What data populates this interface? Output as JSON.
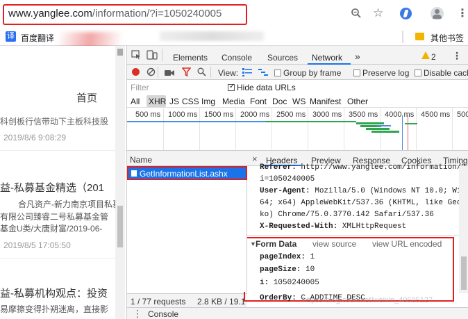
{
  "browser": {
    "url_host": "www.yanglee.com",
    "url_path": "/information/?i=1050240005",
    "bookmarks": [
      {
        "label": "百度翻译",
        "icon": "译"
      }
    ],
    "other_bookmarks": "其他书签",
    "accent": "#e02020"
  },
  "page": {
    "nav_home": "首页",
    "items": [
      {
        "line1": "科创板行信带动下主板科技股",
        "date": "2019/8/6 9:08:29"
      },
      {
        "title": "私募基金精选（201",
        "title_prefix": "益-",
        "lines": [
          "合凡资产-新力南京项目私募",
          "有限公司臻睿二号私募基金管",
          "基金U类/大唐财富/2019-06-"
        ],
        "date": "2019/8/5 17:05:50"
      },
      {
        "title": "私募机构观点：投资",
        "title_prefix": "益-",
        "line1": "易摩擦变得扑朔迷离，直接影"
      }
    ]
  },
  "devtools": {
    "tabs": [
      "Elements",
      "Console",
      "Sources",
      "Network"
    ],
    "active_tab": "Network",
    "more": "»",
    "warnings": "2",
    "toolbar": {
      "view_label": "View:",
      "group_by_frame": "Group by frame",
      "preserve_log": "Preserve log",
      "disable_cache": "Disable cach"
    },
    "filter_placeholder": "Filter",
    "hide_data_urls": "Hide data URLs",
    "type_filters": [
      "All",
      "XHR",
      "JS",
      "CSS",
      "Img",
      "Media",
      "Font",
      "Doc",
      "WS",
      "Manifest",
      "Other"
    ],
    "active_type": "XHR",
    "timeline_ticks": [
      "500 ms",
      "1000 ms",
      "1500 ms",
      "2000 ms",
      "2500 ms",
      "3000 ms",
      "3500 ms",
      "4000 ms",
      "4500 ms",
      "500"
    ],
    "name_header": "Name",
    "request_name": "GetInformationList.ashx",
    "detail_tabs": [
      "Headers",
      "Preview",
      "Response",
      "Cookies",
      "Timing"
    ],
    "close_glyph": "×",
    "headers": {
      "referer_label": "Referer:",
      "referer_value": "http://www.yanglee.com/information/?",
      "referer_cont": "i=1050240005",
      "ua_label": "User-Agent:",
      "ua_lines": [
        "Mozilla/5.0 (Windows NT 10.0; Win",
        "64; x64) AppleWebKit/537.36 (KHTML, like Gec",
        "ko) Chrome/75.0.3770.142 Safari/537.36"
      ],
      "xrw_label": "X-Requested-With:",
      "xrw_value": "XMLHttpRequest"
    },
    "form_data": {
      "title": "Form Data",
      "view_source": "view source",
      "view_url_encoded": "view URL encoded",
      "fields": [
        {
          "key": "pageIndex:",
          "value": "1"
        },
        {
          "key": "pageSize:",
          "value": "10"
        },
        {
          "key": "i:",
          "value": "1050240005"
        },
        {
          "key": "OrderBy:",
          "value": "C_ADDTIME DESC"
        }
      ]
    },
    "status": {
      "requests": "1 / 77 requests",
      "transferred": "2.8 KB / 19.1"
    },
    "watermark": "https://blog.csdn.net/weixin_40605127",
    "drawer": "Console"
  }
}
